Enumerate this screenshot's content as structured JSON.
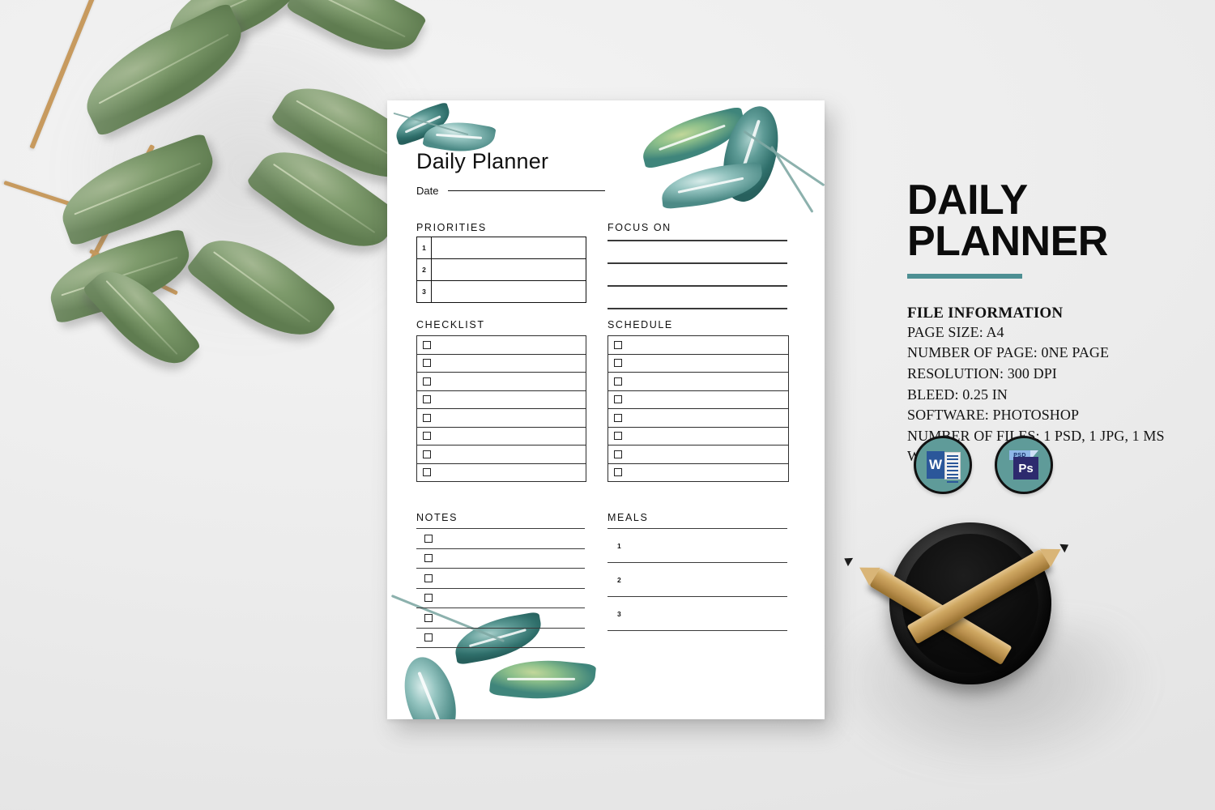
{
  "background": {
    "color": "#efefef",
    "accent_color": "#5f9b99",
    "decor": [
      "green-leaf-branch-photo",
      "black-pencil-cup-with-two-pencils"
    ]
  },
  "planner": {
    "title": "Daily Planner",
    "date_label": "Date",
    "sections": {
      "priorities": {
        "label": "PRIORITIES",
        "rows": [
          "1",
          "2",
          "3"
        ]
      },
      "focus_on": {
        "label": "FOCUS ON",
        "line_count": 4
      },
      "checklist": {
        "label": "CHECKLIST",
        "row_count": 8
      },
      "schedule": {
        "label": "SCHEDULE",
        "row_count": 8
      },
      "notes": {
        "label": "NOTES",
        "row_count": 6
      },
      "meals": {
        "label": "MEALS",
        "rows": [
          "1",
          "2",
          "3"
        ]
      }
    }
  },
  "info_panel": {
    "title_line1": "DAILY",
    "title_line2": "PLANNER",
    "accent_color": "#4d8f93",
    "file_information_heading": "FILE INFORMATION",
    "file_information": [
      "PAGE SIZE: A4",
      "NUMBER OF PAGE: 0NE PAGE",
      "RESOLUTION: 300 DPI",
      "BLEED: 0.25 IN",
      "SOFTWARE: PHOTOSHOP",
      "NUMBER OF FILES: 1 PSD, 1 JPG, 1 MS WORD"
    ],
    "badges": [
      {
        "name": "ms-word-icon",
        "letter": "W"
      },
      {
        "name": "photoshop-psd-icon",
        "tab": "PSD",
        "letter": "Ps"
      }
    ]
  }
}
